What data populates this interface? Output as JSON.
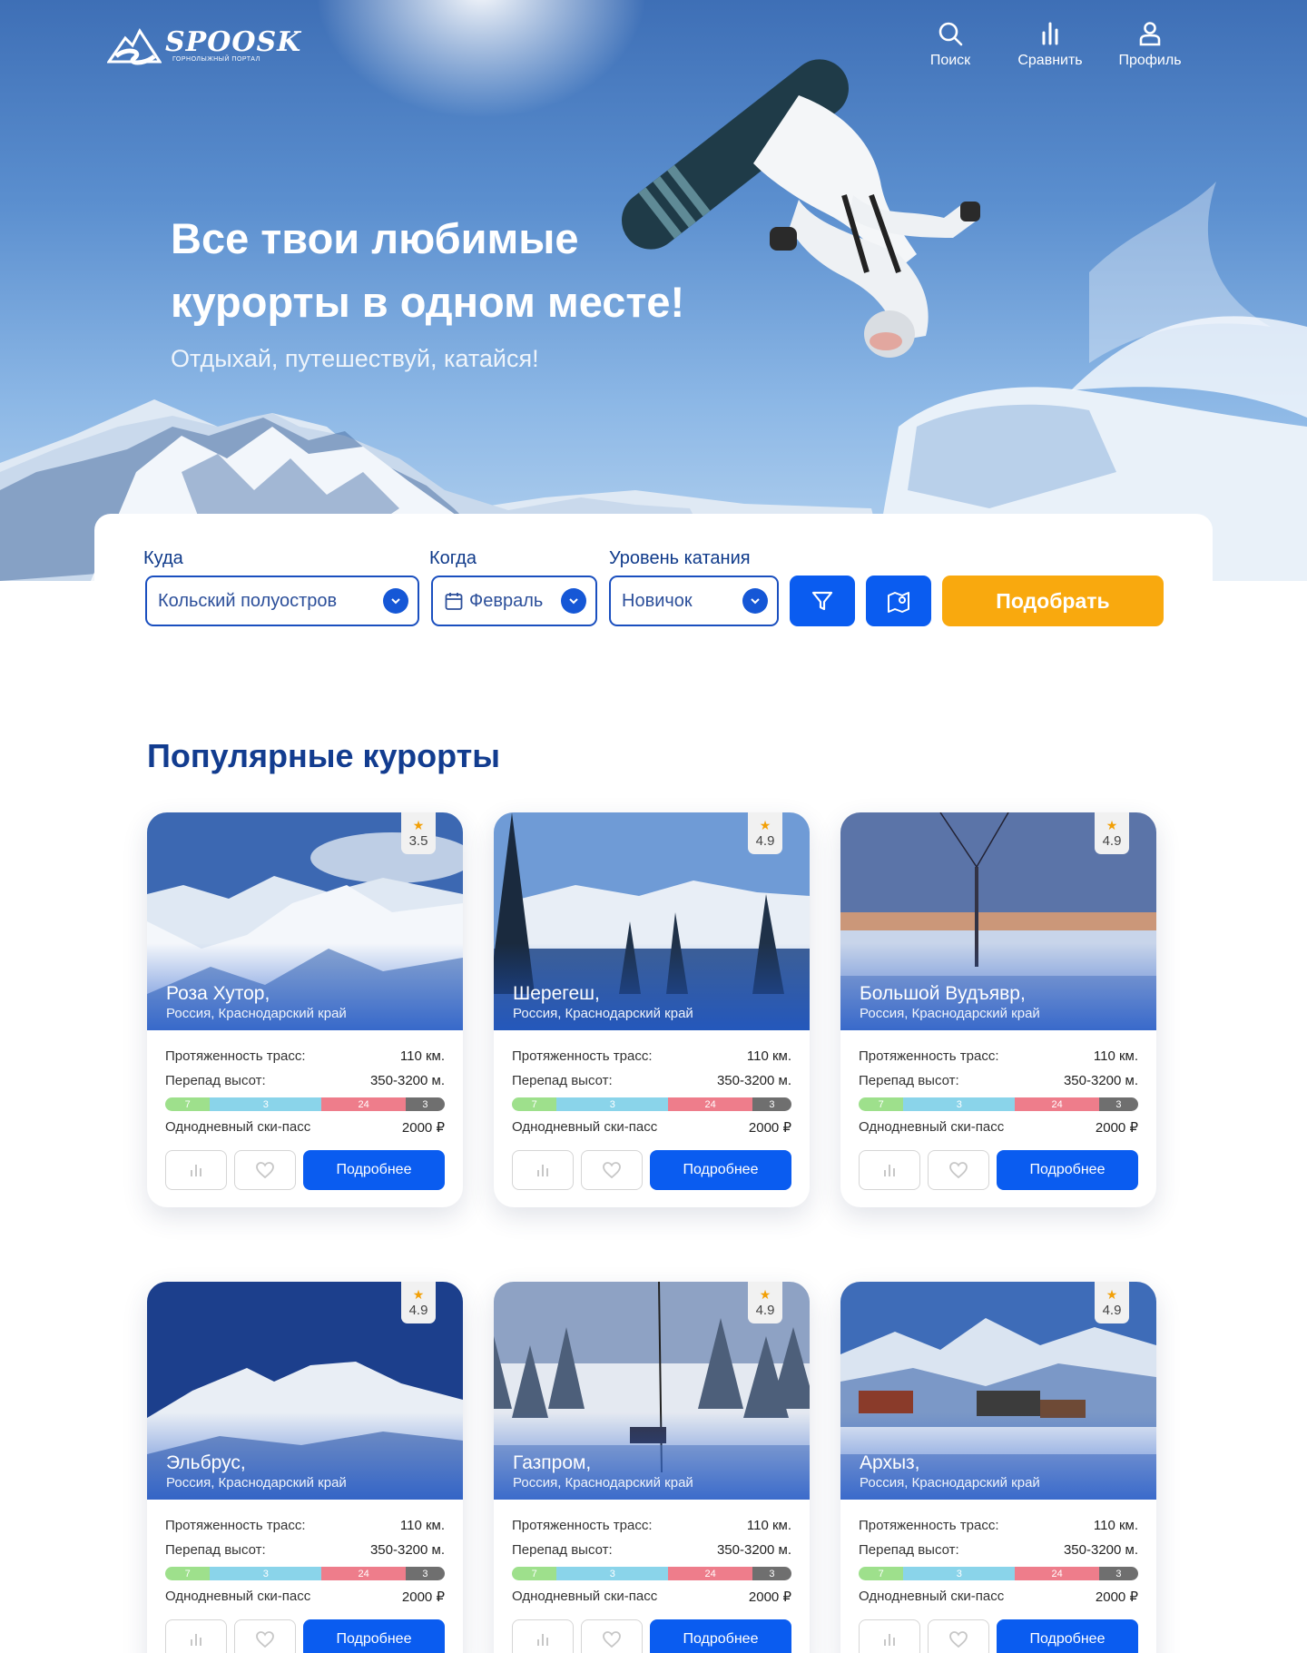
{
  "header": {
    "logo_name": "SPOOSK",
    "logo_sub": "ГОРНОЛЫЖНЫЙ ПОРТАЛ",
    "nav": [
      {
        "label": "Поиск",
        "icon": "search-icon"
      },
      {
        "label": "Сравнить",
        "icon": "chart-icon"
      },
      {
        "label": "Профиль",
        "icon": "user-icon"
      }
    ]
  },
  "hero": {
    "title": "Все твои любимые курорты в одном месте!",
    "subtitle": "Отдыхай, путешествуй, катайся!"
  },
  "search": {
    "where_label": "Куда",
    "where_value": "Кольский полуостров",
    "when_label": "Когда",
    "when_value": "Февраль",
    "level_label": "Уровень катания",
    "level_value": "Новичок",
    "filter_icon": "filter-icon",
    "map_icon": "map-pin-icon",
    "submit_label": "Подобрать"
  },
  "colors": {
    "primary": "#0a5cf0",
    "accent": "#f9a90e",
    "heading": "#123c8f",
    "green_run": "#9ee08c",
    "blue_run": "#8ad4ea",
    "red_run": "#ee7d8b",
    "black_run": "#6f6f6f"
  },
  "popular": {
    "title": "Популярные курорты",
    "labels": {
      "length": "Протяженность трасс:",
      "drop": "Перепад высот:",
      "pass": "Однодневный ски-пасс",
      "more": "Подробнее"
    },
    "resorts": [
      {
        "name": "Роза Хутор,",
        "region": "Россия, Краснодарский край",
        "rating": "3.5",
        "length": "110 км.",
        "drop": "350-3200 м.",
        "green": "7",
        "blue": "3",
        "red": "24",
        "black": "3",
        "pass": "2000 ₽"
      },
      {
        "name": "Шерегеш,",
        "region": "Россия, Краснодарский край",
        "rating": "4.9",
        "length": "110 км.",
        "drop": "350-3200 м.",
        "green": "7",
        "blue": "3",
        "red": "24",
        "black": "3",
        "pass": "2000 ₽"
      },
      {
        "name": "Большой Вудъявр,",
        "region": "Россия, Краснодарский край",
        "rating": "4.9",
        "length": "110 км.",
        "drop": "350-3200 м.",
        "green": "7",
        "blue": "3",
        "red": "24",
        "black": "3",
        "pass": "2000 ₽"
      },
      {
        "name": "Эльбрус,",
        "region": "Россия, Краснодарский край",
        "rating": "4.9",
        "length": "110 км.",
        "drop": "350-3200 м.",
        "green": "7",
        "blue": "3",
        "red": "24",
        "black": "3",
        "pass": "2000 ₽"
      },
      {
        "name": "Газпром,",
        "region": "Россия, Краснодарский край",
        "rating": "4.9",
        "length": "110 км.",
        "drop": "350-3200 м.",
        "green": "7",
        "blue": "3",
        "red": "24",
        "black": "3",
        "pass": "2000 ₽"
      },
      {
        "name": "Архыз,",
        "region": "Россия, Краснодарский край",
        "rating": "4.9",
        "length": "110 км.",
        "drop": "350-3200 м.",
        "green": "7",
        "blue": "3",
        "red": "24",
        "black": "3",
        "pass": "2000 ₽"
      }
    ]
  }
}
